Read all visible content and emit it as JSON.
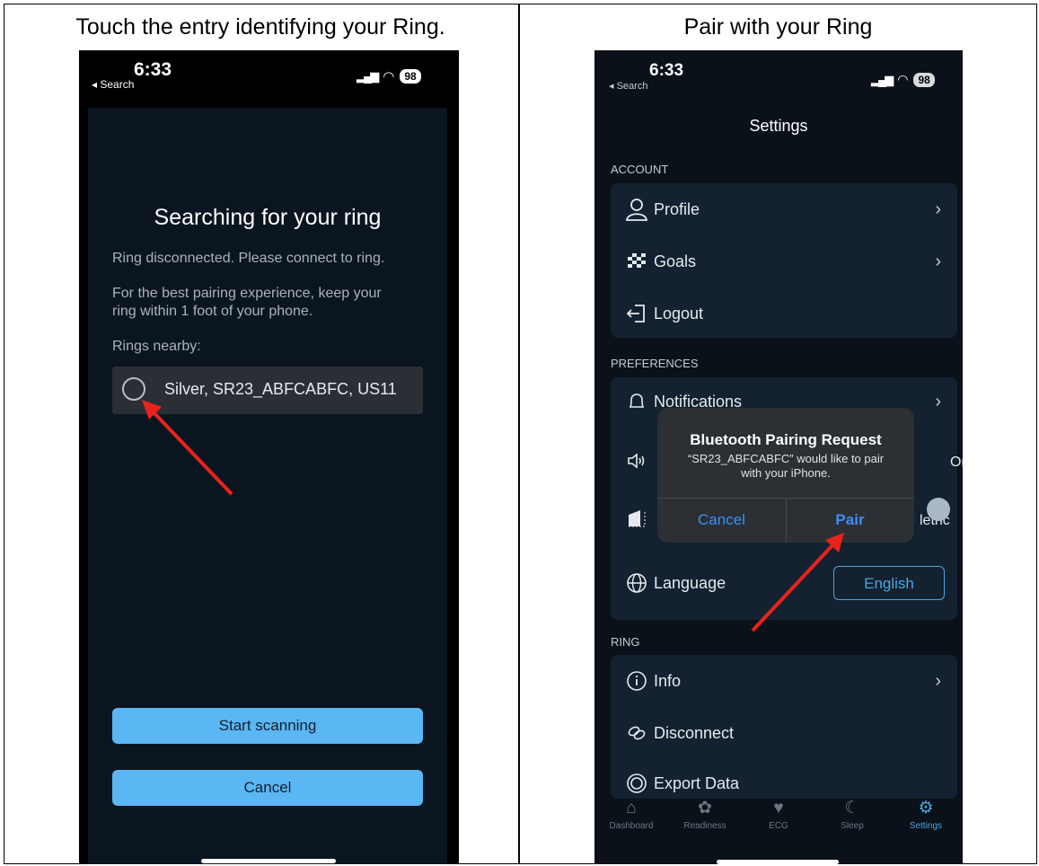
{
  "captions": {
    "left": "Touch the entry identifying your Ring.",
    "right": "Pair with your Ring"
  },
  "status_bar": {
    "time": "6:33",
    "back": "◂ Search",
    "battery": "98"
  },
  "scan_screen": {
    "title": "Searching for your ring",
    "disconnected": "Ring disconnected. Please connect to ring.",
    "tip_line1": "For the best pairing experience, keep your",
    "tip_line2": "ring within 1 foot of your phone.",
    "nearby_label": "Rings nearby:",
    "ring_entry": "Silver, SR23_ABFCABFC, US11",
    "start_button": "Start scanning",
    "cancel_button": "Cancel"
  },
  "settings_screen": {
    "title": "Settings",
    "sections": {
      "account": "ACCOUNT",
      "preferences": "PREFERENCES",
      "ring": "RING"
    },
    "account_items": [
      "Profile",
      "Goals",
      "Logout"
    ],
    "preferences_items": {
      "notifications": "Notifications",
      "language": "Language",
      "language_value": "English",
      "toggle_value": "On",
      "units_value": "letric"
    },
    "ring_items": [
      "Info",
      "Disconnect",
      "Export Data"
    ],
    "dialog": {
      "title": "Bluetooth Pairing Request",
      "message_line1": "“SR23_ABFCABFC” would like to pair",
      "message_line2": "with your iPhone.",
      "cancel": "Cancel",
      "pair": "Pair"
    },
    "tabs": [
      "Dashboard",
      "Readiness",
      "ECG",
      "Sleep",
      "Settings"
    ],
    "active_tab": "Settings"
  },
  "colors": {
    "accent_blue": "#5ab7f4",
    "arrow_red": "#e8231c",
    "ios_blue": "#3d8ef6"
  }
}
